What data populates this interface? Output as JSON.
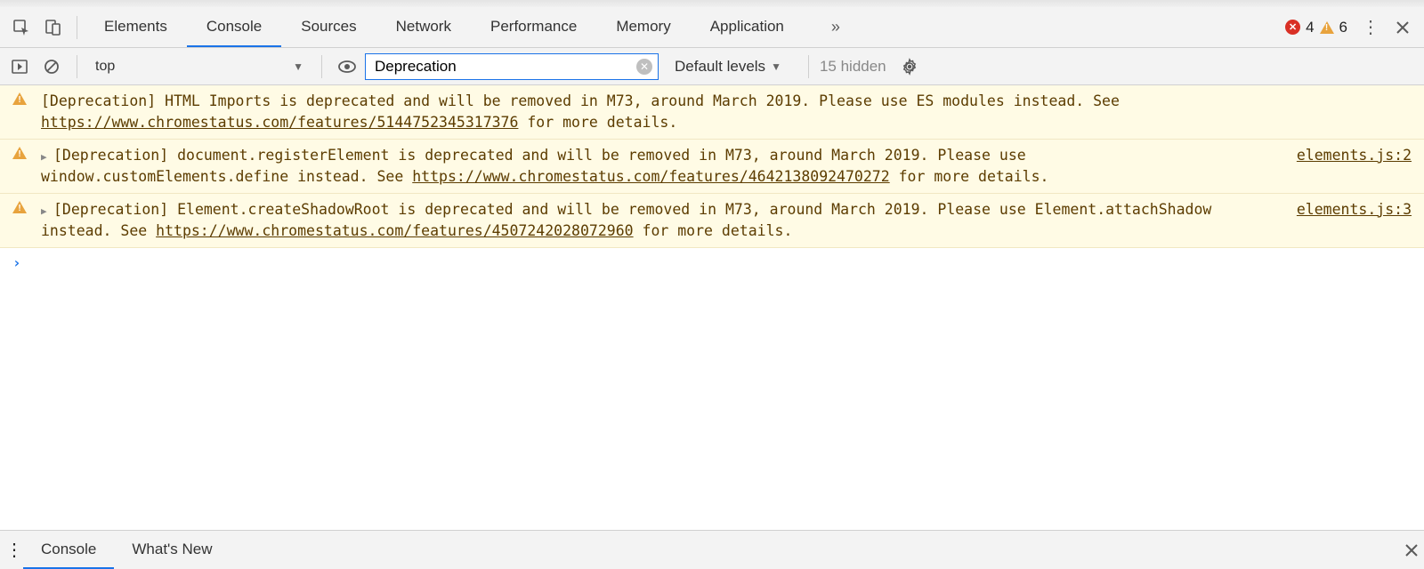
{
  "tabs": {
    "items": [
      "Elements",
      "Console",
      "Sources",
      "Network",
      "Performance",
      "Memory",
      "Application"
    ],
    "active": "Console"
  },
  "status": {
    "error_count": "4",
    "warning_count": "6"
  },
  "toolbar": {
    "context": "top",
    "filter_value": "Deprecation",
    "levels_label": "Default levels",
    "hidden_label": "15 hidden"
  },
  "messages": [
    {
      "expandable": false,
      "pre": "[Deprecation] HTML Imports is deprecated and will be removed in M73, around March 2019. Please use ES modules instead. See ",
      "link": "https://www.chromestatus.com/features/5144752345317376",
      "post": " for more details.",
      "source": ""
    },
    {
      "expandable": true,
      "pre": "[Deprecation] document.registerElement is deprecated and will be removed in M73, around March 2019. Please use window.customElements.define instead. See ",
      "link": "https://www.chromestatus.com/features/4642138092470272",
      "post": " for more details.",
      "source": "elements.js:2"
    },
    {
      "expandable": true,
      "pre": "[Deprecation] Element.createShadowRoot is deprecated and will be removed in M73, around March 2019. Please use Element.attachShadow instead. See ",
      "link": "https://www.chromestatus.com/features/4507242028072960",
      "post": " for more details.",
      "source": "elements.js:3"
    }
  ],
  "drawer": {
    "tabs": [
      "Console",
      "What's New"
    ],
    "active": "Console"
  }
}
